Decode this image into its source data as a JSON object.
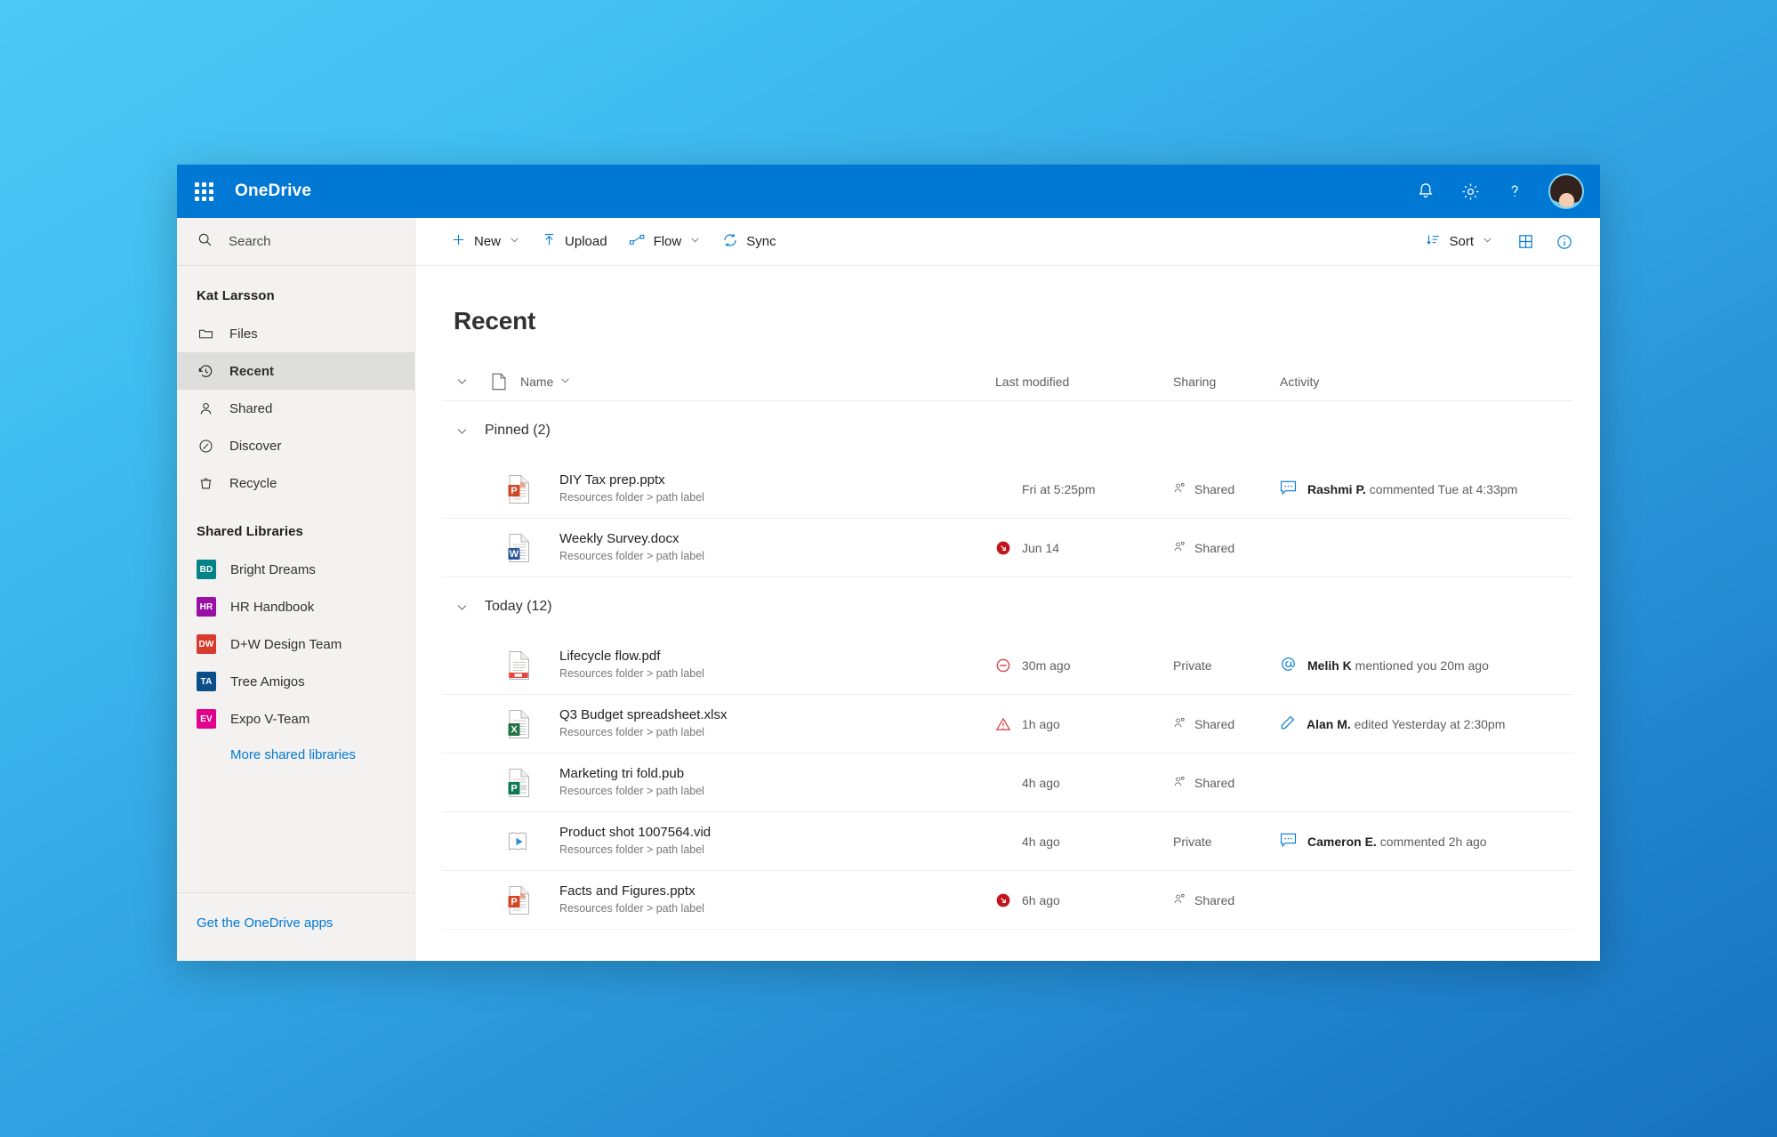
{
  "suite": {
    "waffle_icon": "app-launcher-icon",
    "title": "OneDrive",
    "notifications_icon": "bell-icon",
    "settings_icon": "gear-icon",
    "help_icon": "question-mark-icon",
    "avatar_label": "Kat Larsson"
  },
  "sidebar": {
    "search": {
      "placeholder": "Search",
      "value": "",
      "icon": "search-icon"
    },
    "account_name": "Kat Larsson",
    "nav": [
      {
        "label": "Files",
        "icon": "folder-icon",
        "active": false
      },
      {
        "label": "Recent",
        "icon": "history-icon",
        "active": true
      },
      {
        "label": "Shared",
        "icon": "person-icon",
        "active": false
      },
      {
        "label": "Discover",
        "icon": "compass-icon",
        "active": false
      },
      {
        "label": "Recycle",
        "icon": "trash-icon",
        "active": false
      }
    ],
    "libraries_heading": "Shared Libraries",
    "libraries": [
      {
        "initials": "BD",
        "label": "Bright Dreams",
        "color": "#038387"
      },
      {
        "initials": "HR",
        "label": "HR Handbook",
        "color": "#9a10a6"
      },
      {
        "initials": "DW",
        "label": "D+W Design Team",
        "color": "#d83b2d"
      },
      {
        "initials": "TA",
        "label": "Tree Amigos",
        "color": "#0b4f8a"
      },
      {
        "initials": "EV",
        "label": "Expo V-Team",
        "color": "#e3008c"
      }
    ],
    "more_libraries": "More shared libraries",
    "footer_link": "Get the OneDrive apps"
  },
  "command_bar": {
    "new": {
      "label": "New",
      "icon": "plus-icon",
      "has_chevron": true
    },
    "upload": {
      "label": "Upload",
      "icon": "upload-icon",
      "has_chevron": false
    },
    "flow": {
      "label": "Flow",
      "icon": "flow-icon",
      "has_chevron": true
    },
    "sync": {
      "label": "Sync",
      "icon": "sync-icon",
      "has_chevron": false
    },
    "sort": {
      "label": "Sort",
      "icon": "sort-icon",
      "has_chevron": true
    },
    "view_icon": "grid-view-icon",
    "info_icon": "info-icon"
  },
  "main": {
    "page_title": "Recent",
    "columns": {
      "select_chevron": "chevron-down-icon",
      "file_icon": "file-type-icon",
      "name": "Name",
      "name_chevron": "chevron-down-icon",
      "last_modified": "Last modified",
      "sharing": "Sharing",
      "activity": "Activity"
    },
    "groups": [
      {
        "label": "Pinned (2)",
        "chevron": "chevron-down-icon",
        "rows": [
          {
            "name": "DIY Tax prep.pptx",
            "path": "Resources folder > path label",
            "file_type": "powerpoint",
            "modified": "Fri at 5:25pm",
            "status_icon": "",
            "sharing": "Shared",
            "sharing_icon": "people-icon",
            "activity_icon": "comment-icon",
            "activity_actor": "Rashmi P.",
            "activity_text": " commented Tue at 4:33pm"
          },
          {
            "name": "Weekly Survey.docx",
            "path": "Resources folder > path label",
            "file_type": "word",
            "modified": "Jun 14",
            "status_icon": "blocked-download-icon",
            "sharing": "Shared",
            "sharing_icon": "people-icon",
            "activity_icon": "",
            "activity_actor": "",
            "activity_text": ""
          }
        ]
      },
      {
        "label": "Today (12)",
        "chevron": "chevron-down-icon",
        "rows": [
          {
            "name": "Lifecycle flow.pdf",
            "path": "Resources folder > path label",
            "file_type": "pdf",
            "modified": "30m ago",
            "status_icon": "blocked-circle-icon",
            "sharing": "Private",
            "sharing_icon": "",
            "activity_icon": "mention-icon",
            "activity_actor": "Melih K",
            "activity_text": " mentioned you 20m ago"
          },
          {
            "name": "Q3 Budget spreadsheet.xlsx",
            "path": "Resources folder > path label",
            "file_type": "excel",
            "modified": "1h ago",
            "status_icon": "warning-triangle-icon",
            "sharing": "Shared",
            "sharing_icon": "people-icon",
            "activity_icon": "pencil-icon",
            "activity_actor": "Alan M.",
            "activity_text": " edited Yesterday at 2:30pm"
          },
          {
            "name": "Marketing tri fold.pub",
            "path": "Resources folder > path label",
            "file_type": "publisher",
            "modified": "4h ago",
            "status_icon": "",
            "sharing": "Shared",
            "sharing_icon": "people-icon",
            "activity_icon": "",
            "activity_actor": "",
            "activity_text": ""
          },
          {
            "name": "Product shot 1007564.vid",
            "path": "Resources folder > path label",
            "file_type": "video",
            "modified": "4h ago",
            "status_icon": "",
            "sharing": "Private",
            "sharing_icon": "",
            "activity_icon": "comment-icon",
            "activity_actor": "Cameron E.",
            "activity_text": " commented 2h ago"
          },
          {
            "name": "Facts and Figures.pptx",
            "path": "Resources folder > path label",
            "file_type": "powerpoint",
            "modified": "6h ago",
            "status_icon": "blocked-download-icon",
            "sharing": "Shared",
            "sharing_icon": "people-icon",
            "activity_icon": "",
            "activity_actor": "",
            "activity_text": ""
          }
        ]
      }
    ]
  },
  "colors": {
    "brand": "#0078d4",
    "sidebar_bg": "#f3f2f1",
    "active_nav": "#dededd",
    "status_red": "#c4314b",
    "warning_red": "#d13438"
  }
}
